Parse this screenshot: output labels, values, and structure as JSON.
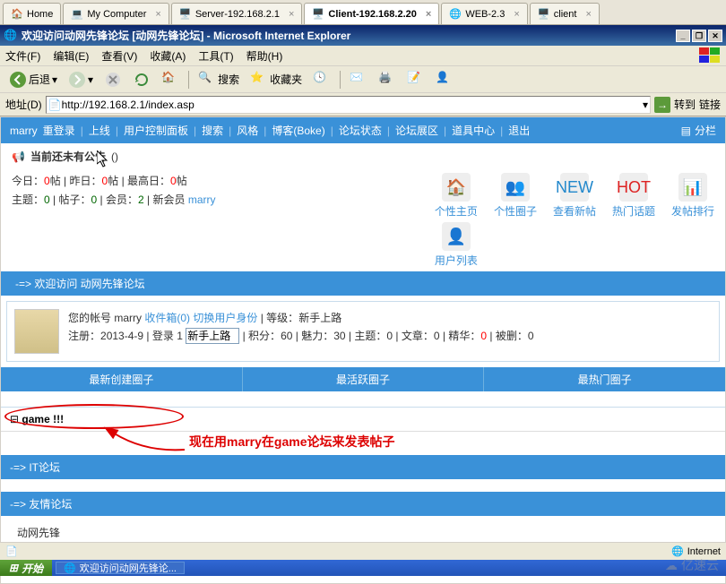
{
  "app_tabs": [
    {
      "label": "Home",
      "icon": "home"
    },
    {
      "label": "My Computer",
      "icon": "computer"
    },
    {
      "label": "Server-192.168.2.1",
      "icon": "server"
    },
    {
      "label": "Client-192.168.2.20",
      "icon": "client",
      "active": true
    },
    {
      "label": "WEB-2.3",
      "icon": "web"
    },
    {
      "label": "client",
      "icon": "client"
    }
  ],
  "window": {
    "title": "欢迎访问动网先锋论坛 [动网先锋论坛] - Microsoft Internet Explorer"
  },
  "menu": {
    "file": "文件(F)",
    "edit": "编辑(E)",
    "view": "查看(V)",
    "favorites": "收藏(A)",
    "tools": "工具(T)",
    "help": "帮助(H)"
  },
  "toolbar": {
    "back": "后退",
    "search": "搜索",
    "favorites": "收藏夹"
  },
  "address": {
    "label": "地址(D)",
    "url": "http://192.168.2.1/index.asp",
    "go": "转到",
    "links": "链接"
  },
  "forum_nav": {
    "user": "marry",
    "relogin": "重登录",
    "online": "上线",
    "panel": "用户控制面板",
    "search": "搜索",
    "style": "风格",
    "boke": "博客(Boke)",
    "status": "论坛状态",
    "exhibit": "论坛展区",
    "tools": "道具中心",
    "logout": "退出",
    "split": "分栏"
  },
  "announce": {
    "text": "当前还未有公告",
    "paren": "()"
  },
  "stats": {
    "line1": "今日：<r>0</r>帖 | 昨日：<r>0</r>帖 | 最高日：<r>0</r>帖",
    "today_label": "今日：",
    "today_val": "0",
    "post_suffix": "帖",
    "yesterday_label": "昨日：",
    "yesterday_val": "0",
    "maxday_label": "最高日：",
    "maxday_val": "0",
    "topics_label": "主题：",
    "topics_val": "0",
    "posts_label": "帖子：",
    "posts_val": "0",
    "members_label": "会员：",
    "members_val": "2",
    "newmember_label": "新会员",
    "newmember_val": "marry"
  },
  "icon_links": {
    "home": "个性主页",
    "circle": "个性圈子",
    "newposts": "查看新帖",
    "hot": "热门话题",
    "ranking": "发帖排行",
    "userlist": "用户列表"
  },
  "welcome_bar": "-=> 欢迎访问 动网先锋论坛",
  "user_box": {
    "line1_prefix": "您的帐号 marry",
    "inbox": "收件箱(0)",
    "switch": "切换用户身份",
    "level_label": "等级：",
    "level_val": "新手上路",
    "reg_label": "注册：",
    "reg_val": "2013-4-9",
    "login_label": "登录",
    "login_val": "1",
    "level_input": "新手上路",
    "points_label": "积分：",
    "points_val": "60",
    "charm_label": "魅力：",
    "charm_val": "30",
    "topics2_label": "主题：",
    "topics2_val": "0",
    "articles_label": "文章：",
    "articles_val": "0",
    "essence_label": "精华：",
    "essence_val": "0",
    "deleted_label": "被删：",
    "deleted_val": "0"
  },
  "cols": {
    "newest": "最新创建圈子",
    "active": "最活跃圈子",
    "hot": "最热门圈子"
  },
  "game_row": {
    "icon": "⊟",
    "label": "game !!!"
  },
  "annotation": "现在用marry在game论坛来发表帖子",
  "it_bar": "-=> IT论坛",
  "friendship_bar": "-=> 友情论坛",
  "friendship_item": "动网先锋",
  "status_bar": {
    "internet": "Internet"
  },
  "taskbar": {
    "start": "开始",
    "task1": "欢迎访问动网先锋论..."
  },
  "watermark": "亿速云"
}
